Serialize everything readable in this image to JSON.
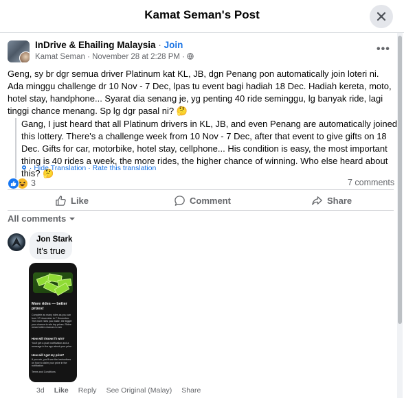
{
  "header": {
    "title": "Kamat Seman's Post"
  },
  "post": {
    "group_name": "InDrive & Ehailing Malaysia",
    "separator": " · ",
    "join_label": "Join",
    "author": "Kamat Seman",
    "date": "November 28 at 2:28 PM",
    "privacy_icon": "globe-icon",
    "text": "Geng, sy br dgr semua driver Platinum kat KL, JB, dgn Penang pon automatically join loteri ni. Ada minggu challenge dr 10 Nov - 7 Dec, lpas tu event bagi hadiah 18 Dec. Hadiah kereta, moto, hotel stay, handphone... Syarat dia senang je, yg penting 40 ride seminggu, lg banyak ride, lagi tinggi chance menang. Sp lg dgr pasal ni? 🤔",
    "translation": "Gang, I just heard that all Platinum drivers in KL, JB, and even Penang are automatically joined this lottery. There's a challenge week from 10 Nov - 7 Dec, after that event to give gifts on 18 Dec. Gifts for car, motorbike, hotel stay, cellphone... His condition is easy, the most important thing is 40 rides a week, the more rides, the higher chance of winning. Who else heard about this? 🤔",
    "hide_translation": "Hide Translation",
    "rate_translation": "Rate this translation",
    "reaction_count": "3",
    "comments_count": "7 comments"
  },
  "actions": {
    "like": "Like",
    "comment": "Comment",
    "share": "Share"
  },
  "comments_filter": "All comments",
  "comment": {
    "author": "Jon Stark",
    "text": "It's true",
    "time": "3d",
    "like": "Like",
    "reply": "Reply",
    "see_original": "See Original (Malay)",
    "share": "Share",
    "image": {
      "heading": "More rides — better prizes!",
      "body": "Complete as many rides as you can from 17 November to 7 December. The more rides you make, the bigger your chance to win top prizes. Rides mean better chances to win",
      "q1": "How will I know if I win?",
      "a1": "You'll get a push notification and a message in the app about your prize",
      "q2": "How will I get my prize?",
      "a2": "If you win, you'll see the instructions on how to claim your prize in the notification",
      "terms": "Terms and Conditions"
    }
  }
}
